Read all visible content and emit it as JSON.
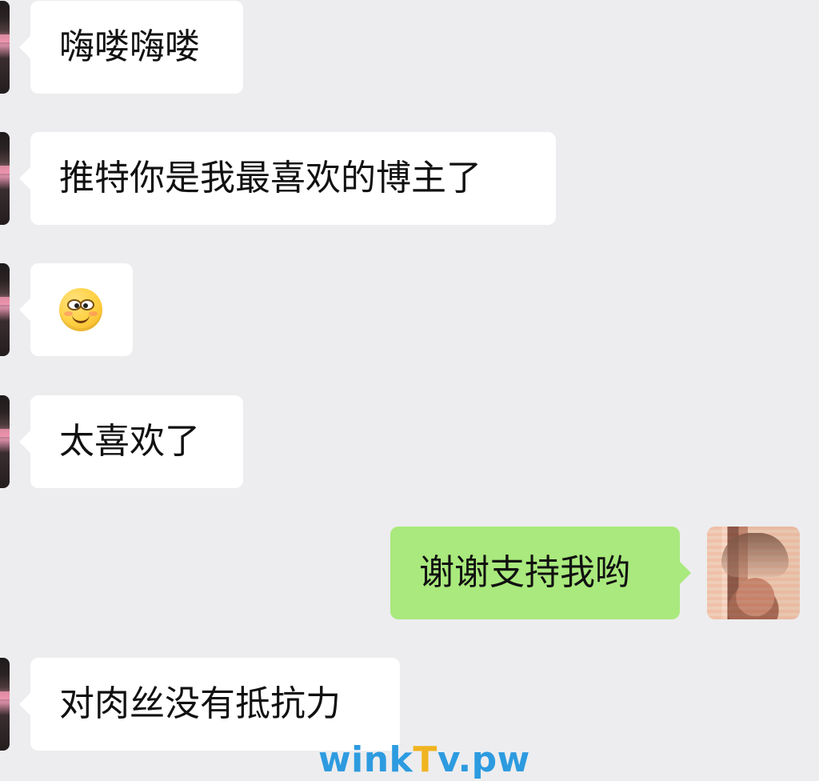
{
  "chat": {
    "messages": [
      {
        "text": "嗨喽嗨喽"
      },
      {
        "text": "推特你是我最喜欢的博主了"
      },
      {
        "emoji": "smiling-face-with-blush-icon"
      },
      {
        "text": "太喜欢了"
      },
      {
        "text": "谢谢支持我哟"
      },
      {
        "text": "对肉丝没有抵抗力"
      }
    ]
  },
  "watermark": {
    "prefix": "wink",
    "accent": "T",
    "suffix": "v.pw"
  },
  "colors": {
    "background": "#ededef",
    "incoming_bubble": "#ffffff",
    "outgoing_bubble": "#a9e97d",
    "watermark_primary": "#2d9be0",
    "watermark_accent": "#f0b420"
  }
}
